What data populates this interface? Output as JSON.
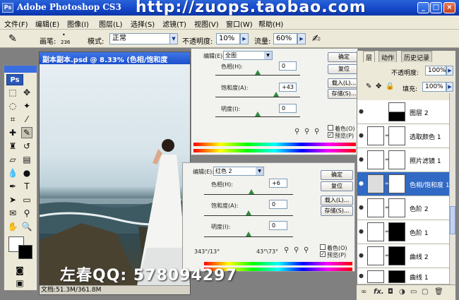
{
  "titlebar": {
    "app_title": "Adobe Photoshop CS3",
    "watermark": "http://zuops.taobao.com",
    "ps_logo": "Ps",
    "minimize": "_",
    "maximize": "□",
    "close": "×"
  },
  "menubar": {
    "items": [
      "文件(F)",
      "编辑(E)",
      "图像(I)",
      "图层(L)",
      "选择(S)",
      "滤镜(T)",
      "视图(V)",
      "窗口(W)",
      "帮助(H)"
    ]
  },
  "options": {
    "brush_label": "画笔:",
    "brush_size": "236",
    "mode_label": "模式:",
    "mode_value": "正常",
    "opacity_label": "不透明度:",
    "opacity_value": "10%",
    "flow_label": "流量:",
    "flow_value": "60%"
  },
  "toolbox": {
    "badge": "Ps"
  },
  "document": {
    "title": "副本副本.psd @ 8.33% (色相/饱和度",
    "status": "文档:51.3M/361.8M"
  },
  "dialog1": {
    "edit_label": "编辑(E):",
    "edit_value": "全图",
    "hue_label": "色相(H):",
    "hue_value": "0",
    "sat_label": "饱和度(A):",
    "sat_value": "+43",
    "light_label": "明度(I):",
    "light_value": "0",
    "ok": "确定",
    "reset": "复位",
    "load": "载入(L)...",
    "save": "存储(S)...",
    "colorize": "着色(O)",
    "preview": "预览(P)",
    "hue_position": 0.5,
    "sat_position": 0.72,
    "light_position": 0.5
  },
  "dialog2": {
    "edit_label": "编辑(E):",
    "edit_value": "红色 2",
    "hue_label": "色相(H):",
    "hue_value": "+6",
    "sat_label": "饱和度(A):",
    "sat_value": "0",
    "light_label": "明度(I):",
    "light_value": "0",
    "ok": "确定",
    "reset": "复位",
    "load": "载入(L)...",
    "save": "存储(S)...",
    "colorize": "着色(O)",
    "preview": "预览(P)",
    "range_left": "343°/13°",
    "range_right": "43°\\73°",
    "hue_position": 0.53,
    "sat_position": 0.5,
    "light_position": 0.5
  },
  "layers": {
    "tabs": [
      "层",
      "动作",
      "历史记录"
    ],
    "opacity_label": "不透明度:",
    "opacity_value": "100%",
    "fill_label": "填充:",
    "fill_value": "100%",
    "items": [
      {
        "name": "图层 2",
        "selected": false
      },
      {
        "name": "选取颜色 1",
        "selected": false
      },
      {
        "name": "照片滤镜 1",
        "selected": false
      },
      {
        "name": "色相/饱和度 1",
        "selected": true
      },
      {
        "name": "色阶 2",
        "selected": false
      },
      {
        "name": "色阶 1",
        "selected": false
      },
      {
        "name": "曲线 2",
        "selected": false
      },
      {
        "name": "曲线 1",
        "selected": false
      }
    ]
  },
  "bottom_watermark": "左春QQ: 578094297"
}
